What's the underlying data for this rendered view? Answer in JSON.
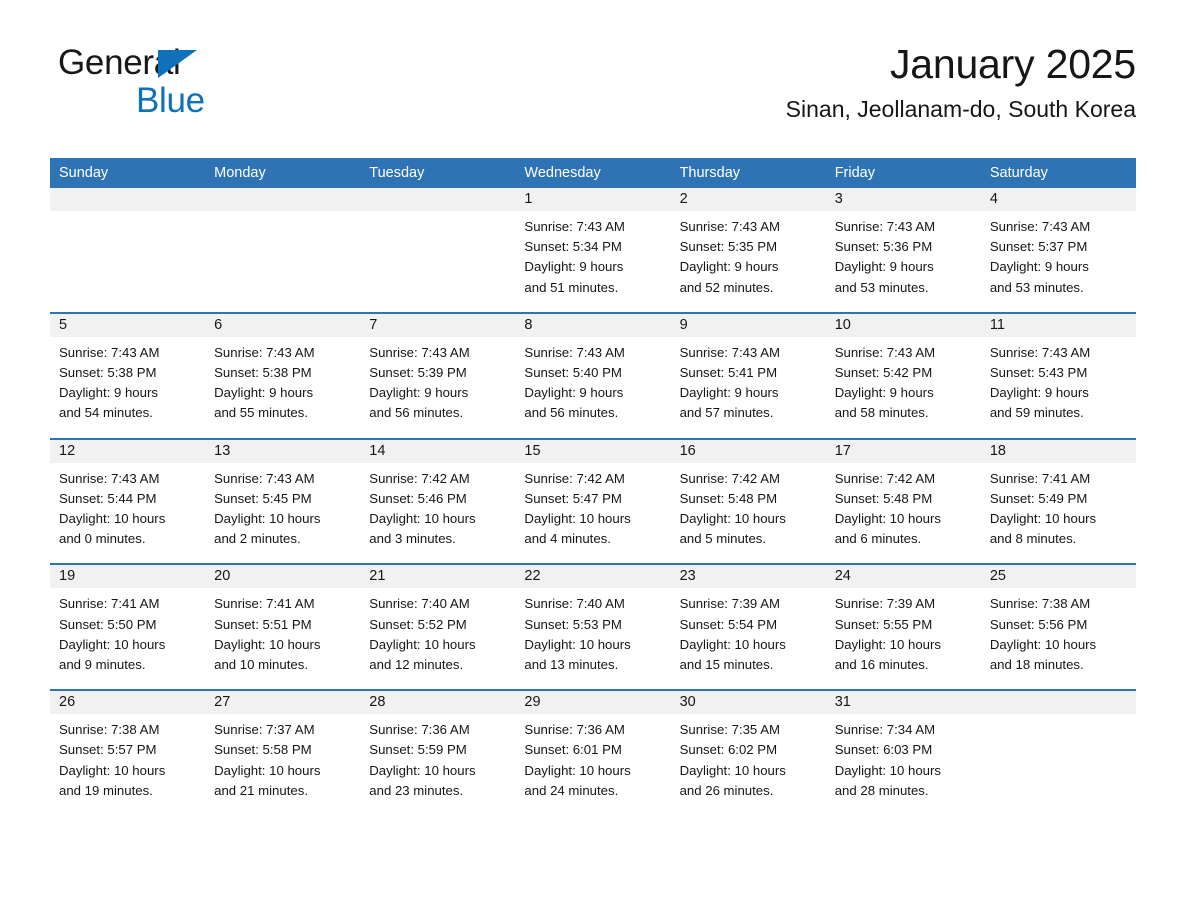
{
  "brand": {
    "name_top": "General",
    "name_bottom": "Blue",
    "accent_color": "#1071bb",
    "triangle_icon": "triangle-icon"
  },
  "header": {
    "title": "January 2025",
    "subtitle": "Sinan, Jeollanam-do, South Korea"
  },
  "theme": {
    "header_blue": "#2e74b5",
    "day_strip_gray": "#f1f1f1",
    "text": "#161616"
  },
  "calendar": {
    "weekday_headers": [
      "Sunday",
      "Monday",
      "Tuesday",
      "Wednesday",
      "Thursday",
      "Friday",
      "Saturday"
    ],
    "weeks": [
      [
        {
          "day": "",
          "lines": []
        },
        {
          "day": "",
          "lines": []
        },
        {
          "day": "",
          "lines": []
        },
        {
          "day": "1",
          "lines": [
            "Sunrise: 7:43 AM",
            "Sunset: 5:34 PM",
            "Daylight: 9 hours",
            "and 51 minutes."
          ]
        },
        {
          "day": "2",
          "lines": [
            "Sunrise: 7:43 AM",
            "Sunset: 5:35 PM",
            "Daylight: 9 hours",
            "and 52 minutes."
          ]
        },
        {
          "day": "3",
          "lines": [
            "Sunrise: 7:43 AM",
            "Sunset: 5:36 PM",
            "Daylight: 9 hours",
            "and 53 minutes."
          ]
        },
        {
          "day": "4",
          "lines": [
            "Sunrise: 7:43 AM",
            "Sunset: 5:37 PM",
            "Daylight: 9 hours",
            "and 53 minutes."
          ]
        }
      ],
      [
        {
          "day": "5",
          "lines": [
            "Sunrise: 7:43 AM",
            "Sunset: 5:38 PM",
            "Daylight: 9 hours",
            "and 54 minutes."
          ]
        },
        {
          "day": "6",
          "lines": [
            "Sunrise: 7:43 AM",
            "Sunset: 5:38 PM",
            "Daylight: 9 hours",
            "and 55 minutes."
          ]
        },
        {
          "day": "7",
          "lines": [
            "Sunrise: 7:43 AM",
            "Sunset: 5:39 PM",
            "Daylight: 9 hours",
            "and 56 minutes."
          ]
        },
        {
          "day": "8",
          "lines": [
            "Sunrise: 7:43 AM",
            "Sunset: 5:40 PM",
            "Daylight: 9 hours",
            "and 56 minutes."
          ]
        },
        {
          "day": "9",
          "lines": [
            "Sunrise: 7:43 AM",
            "Sunset: 5:41 PM",
            "Daylight: 9 hours",
            "and 57 minutes."
          ]
        },
        {
          "day": "10",
          "lines": [
            "Sunrise: 7:43 AM",
            "Sunset: 5:42 PM",
            "Daylight: 9 hours",
            "and 58 minutes."
          ]
        },
        {
          "day": "11",
          "lines": [
            "Sunrise: 7:43 AM",
            "Sunset: 5:43 PM",
            "Daylight: 9 hours",
            "and 59 minutes."
          ]
        }
      ],
      [
        {
          "day": "12",
          "lines": [
            "Sunrise: 7:43 AM",
            "Sunset: 5:44 PM",
            "Daylight: 10 hours",
            "and 0 minutes."
          ]
        },
        {
          "day": "13",
          "lines": [
            "Sunrise: 7:43 AM",
            "Sunset: 5:45 PM",
            "Daylight: 10 hours",
            "and 2 minutes."
          ]
        },
        {
          "day": "14",
          "lines": [
            "Sunrise: 7:42 AM",
            "Sunset: 5:46 PM",
            "Daylight: 10 hours",
            "and 3 minutes."
          ]
        },
        {
          "day": "15",
          "lines": [
            "Sunrise: 7:42 AM",
            "Sunset: 5:47 PM",
            "Daylight: 10 hours",
            "and 4 minutes."
          ]
        },
        {
          "day": "16",
          "lines": [
            "Sunrise: 7:42 AM",
            "Sunset: 5:48 PM",
            "Daylight: 10 hours",
            "and 5 minutes."
          ]
        },
        {
          "day": "17",
          "lines": [
            "Sunrise: 7:42 AM",
            "Sunset: 5:48 PM",
            "Daylight: 10 hours",
            "and 6 minutes."
          ]
        },
        {
          "day": "18",
          "lines": [
            "Sunrise: 7:41 AM",
            "Sunset: 5:49 PM",
            "Daylight: 10 hours",
            "and 8 minutes."
          ]
        }
      ],
      [
        {
          "day": "19",
          "lines": [
            "Sunrise: 7:41 AM",
            "Sunset: 5:50 PM",
            "Daylight: 10 hours",
            "and 9 minutes."
          ]
        },
        {
          "day": "20",
          "lines": [
            "Sunrise: 7:41 AM",
            "Sunset: 5:51 PM",
            "Daylight: 10 hours",
            "and 10 minutes."
          ]
        },
        {
          "day": "21",
          "lines": [
            "Sunrise: 7:40 AM",
            "Sunset: 5:52 PM",
            "Daylight: 10 hours",
            "and 12 minutes."
          ]
        },
        {
          "day": "22",
          "lines": [
            "Sunrise: 7:40 AM",
            "Sunset: 5:53 PM",
            "Daylight: 10 hours",
            "and 13 minutes."
          ]
        },
        {
          "day": "23",
          "lines": [
            "Sunrise: 7:39 AM",
            "Sunset: 5:54 PM",
            "Daylight: 10 hours",
            "and 15 minutes."
          ]
        },
        {
          "day": "24",
          "lines": [
            "Sunrise: 7:39 AM",
            "Sunset: 5:55 PM",
            "Daylight: 10 hours",
            "and 16 minutes."
          ]
        },
        {
          "day": "25",
          "lines": [
            "Sunrise: 7:38 AM",
            "Sunset: 5:56 PM",
            "Daylight: 10 hours",
            "and 18 minutes."
          ]
        }
      ],
      [
        {
          "day": "26",
          "lines": [
            "Sunrise: 7:38 AM",
            "Sunset: 5:57 PM",
            "Daylight: 10 hours",
            "and 19 minutes."
          ]
        },
        {
          "day": "27",
          "lines": [
            "Sunrise: 7:37 AM",
            "Sunset: 5:58 PM",
            "Daylight: 10 hours",
            "and 21 minutes."
          ]
        },
        {
          "day": "28",
          "lines": [
            "Sunrise: 7:36 AM",
            "Sunset: 5:59 PM",
            "Daylight: 10 hours",
            "and 23 minutes."
          ]
        },
        {
          "day": "29",
          "lines": [
            "Sunrise: 7:36 AM",
            "Sunset: 6:01 PM",
            "Daylight: 10 hours",
            "and 24 minutes."
          ]
        },
        {
          "day": "30",
          "lines": [
            "Sunrise: 7:35 AM",
            "Sunset: 6:02 PM",
            "Daylight: 10 hours",
            "and 26 minutes."
          ]
        },
        {
          "day": "31",
          "lines": [
            "Sunrise: 7:34 AM",
            "Sunset: 6:03 PM",
            "Daylight: 10 hours",
            "and 28 minutes."
          ]
        },
        {
          "day": "",
          "lines": []
        }
      ]
    ]
  }
}
